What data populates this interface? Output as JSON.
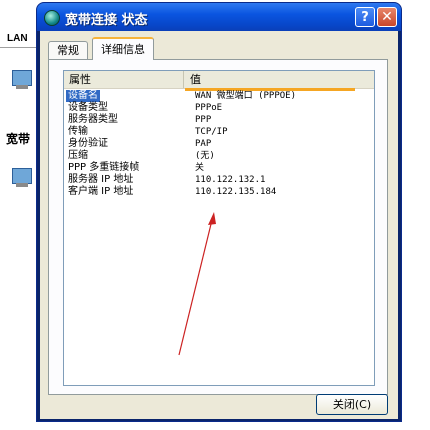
{
  "background": {
    "lan_label": "LAN",
    "broadband_label": "宽带"
  },
  "window": {
    "title": "宽带连接 状态",
    "help_button": "?",
    "close_button": "✕"
  },
  "tabs": [
    {
      "label": "常规",
      "active": false
    },
    {
      "label": "详细信息",
      "active": true
    }
  ],
  "details": {
    "columns": {
      "name": "属性",
      "value": "值"
    },
    "rows": [
      {
        "name": "设备名",
        "value": "WAN 微型端口 (PPPOE)",
        "selected": true
      },
      {
        "name": "设备类型",
        "value": "PPPoE",
        "selected": false
      },
      {
        "name": "服务器类型",
        "value": "PPP",
        "selected": false
      },
      {
        "name": "传输",
        "value": "TCP/IP",
        "selected": false
      },
      {
        "name": "身份验证",
        "value": "PAP",
        "selected": false
      },
      {
        "name": "压缩",
        "value": "(无)",
        "selected": false
      },
      {
        "name": "PPP 多重链接帧",
        "value": "关",
        "selected": false
      },
      {
        "name": "服务器 IP 地址",
        "value": "110.122.132.1",
        "selected": false
      },
      {
        "name": "客户端 IP 地址",
        "value": "110.122.135.184",
        "selected": false
      }
    ]
  },
  "footer": {
    "close_label": "关闭(C)"
  },
  "colors": {
    "selection": "#316ac5",
    "arrow": "#cc2222",
    "titlebar": "#0a55e0"
  },
  "annotation": {
    "icon": "red-arrow-icon"
  }
}
